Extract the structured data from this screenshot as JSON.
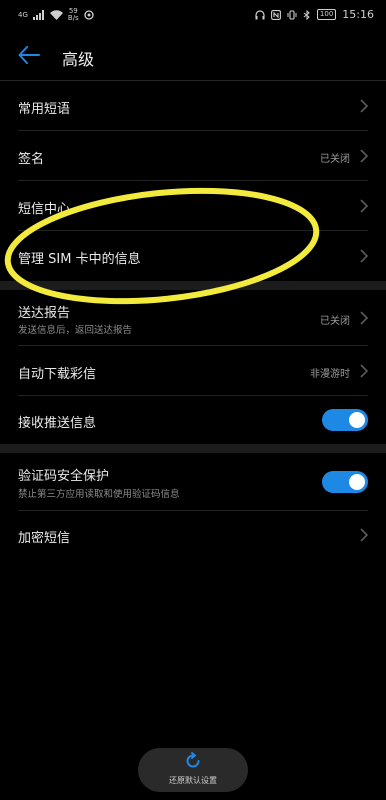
{
  "status_bar": {
    "network": "4G",
    "speed_value": "59",
    "speed_unit": "B/s",
    "battery": "100",
    "time": "15:16"
  },
  "header": {
    "title": "高级"
  },
  "settings": [
    {
      "title": "常用短语"
    },
    {
      "title": "签名",
      "value": "已关闭"
    },
    {
      "title": "短信中心"
    },
    {
      "title": "管理 SIM 卡中的信息"
    },
    {
      "title": "送达报告",
      "subtitle": "发送信息后，返回送达报告",
      "value": "已关闭"
    },
    {
      "title": "自动下载彩信",
      "value": "非漫游时"
    },
    {
      "title": "接收推送信息",
      "toggle": true
    },
    {
      "title": "验证码安全保护",
      "subtitle": "禁止第三方应用读取和使用验证码信息",
      "toggle": true
    },
    {
      "title": "加密短信"
    }
  ],
  "footer": {
    "reset_label": "还原默认设置"
  },
  "colors": {
    "accent": "#1e88e5",
    "highlight": "#f2ea3c",
    "background": "#000000"
  }
}
